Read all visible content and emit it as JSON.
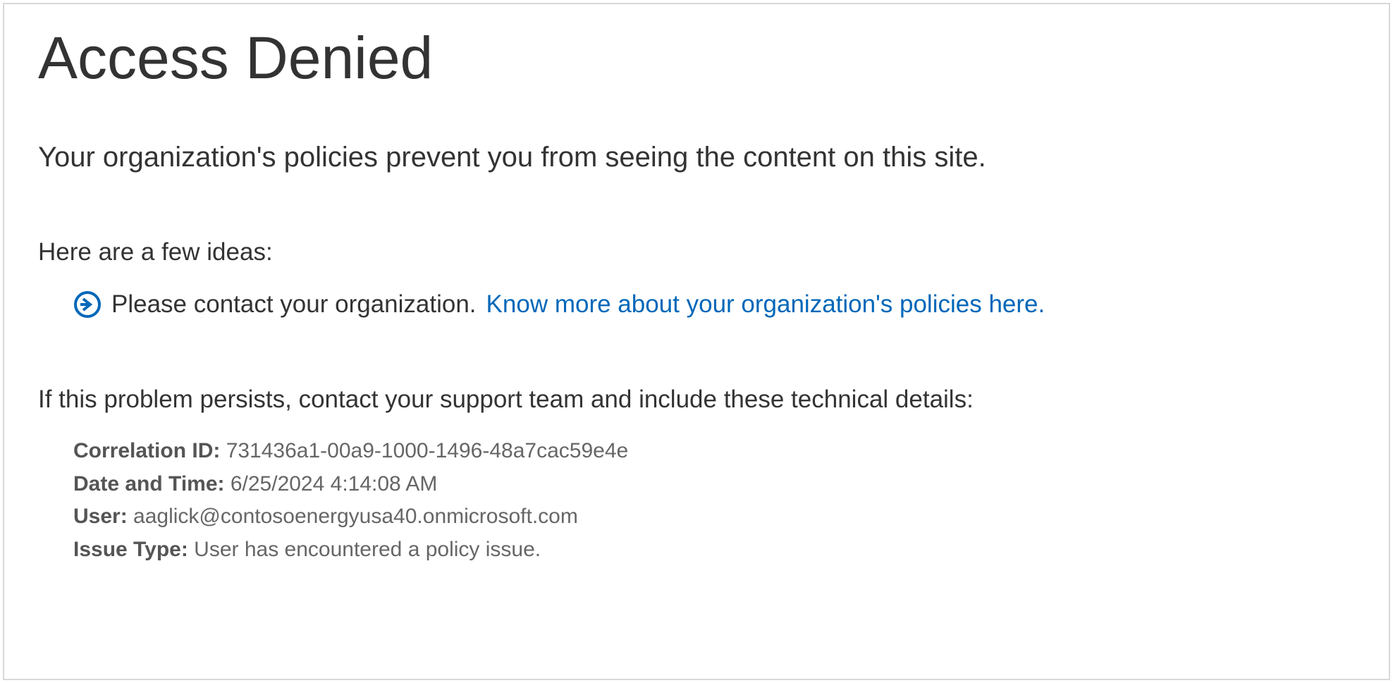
{
  "title": "Access Denied",
  "policy_message": "Your organization's policies prevent you from seeing the content on this site.",
  "ideas_heading": "Here are a few ideas:",
  "idea": {
    "contact_text": "Please contact your organization. ",
    "learn_more_link_text": "Know more about your organization's policies here."
  },
  "persist_heading": "If this problem persists, contact your support team and include these technical details:",
  "details": {
    "correlation_label": "Correlation ID: ",
    "correlation_value": "731436a1-00a9-1000-1496-48a7cac59e4e",
    "datetime_label": "Date and Time: ",
    "datetime_value": "6/25/2024 4:14:08 AM",
    "user_label": "User: ",
    "user_value": "aaglick@contosoenergyusa40.onmicrosoft.com",
    "issue_type_label": "Issue Type: ",
    "issue_type_value": "User has encountered a policy issue."
  },
  "colors": {
    "link": "#0067b8",
    "text_primary": "#333333",
    "text_secondary": "#666666",
    "border": "#d8d8d8"
  }
}
